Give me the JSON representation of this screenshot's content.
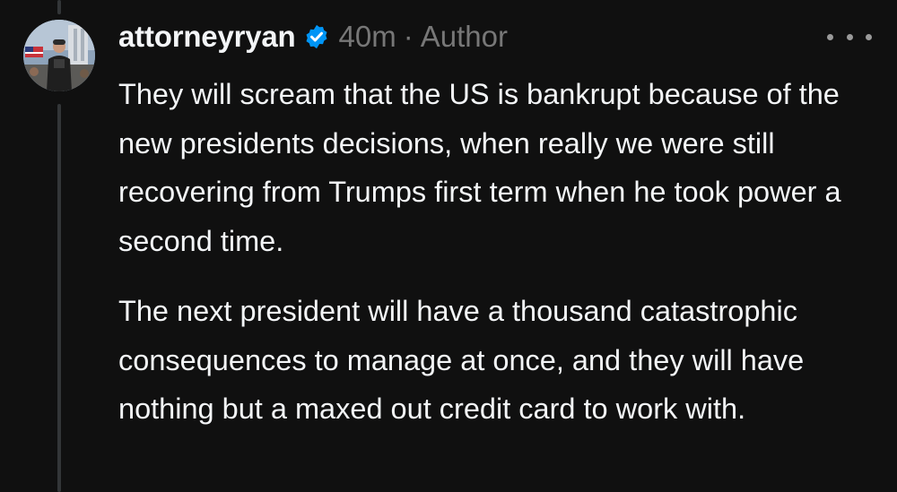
{
  "post": {
    "username": "attorneyryan",
    "timestamp": "40m",
    "separator": "·",
    "role_tag": "Author",
    "paragraphs": [
      "They will scream that the US is bankrupt because of the new presidents decisions, when really we were still recovering from Trumps first term when he took power a second time.",
      "The next president will have a thousand catastrophic consequences to manage at once, and they will have nothing but a maxed out credit card to work with."
    ]
  },
  "icons": {
    "verified": "verified-badge-icon",
    "more": "more-options-icon"
  },
  "colors": {
    "background": "#101010",
    "text": "#f3f5f7",
    "muted": "#777777",
    "verified": "#0095f6",
    "thread_line": "#333638"
  }
}
